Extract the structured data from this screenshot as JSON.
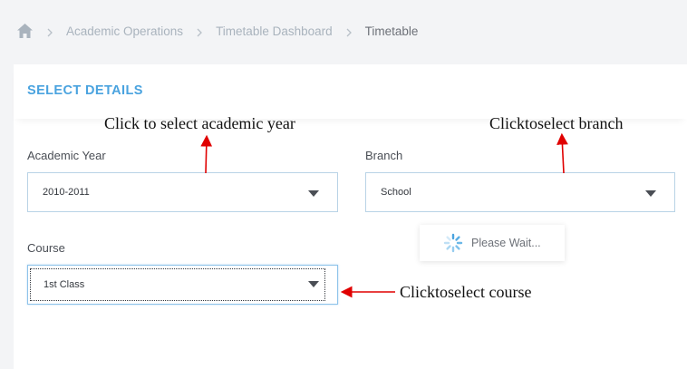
{
  "breadcrumb": {
    "items": [
      {
        "label": "Academic Operations"
      },
      {
        "label": "Timetable Dashboard"
      },
      {
        "label": "Timetable"
      }
    ]
  },
  "panel": {
    "title": "SELECT DETAILS"
  },
  "fields": {
    "academic_year": {
      "label": "Academic Year",
      "value": "2010-2011"
    },
    "branch": {
      "label": "Branch",
      "value": "School"
    },
    "course": {
      "label": "Course",
      "value": "1st Class"
    }
  },
  "loader": {
    "text": "Please Wait..."
  },
  "annotations": {
    "academic_year": "Click to select academic year",
    "branch": "Clicktoselect branch",
    "course": "Clicktoselect course"
  },
  "colors": {
    "accent": "#4aa3df",
    "annotation_arrow": "#e00000"
  }
}
